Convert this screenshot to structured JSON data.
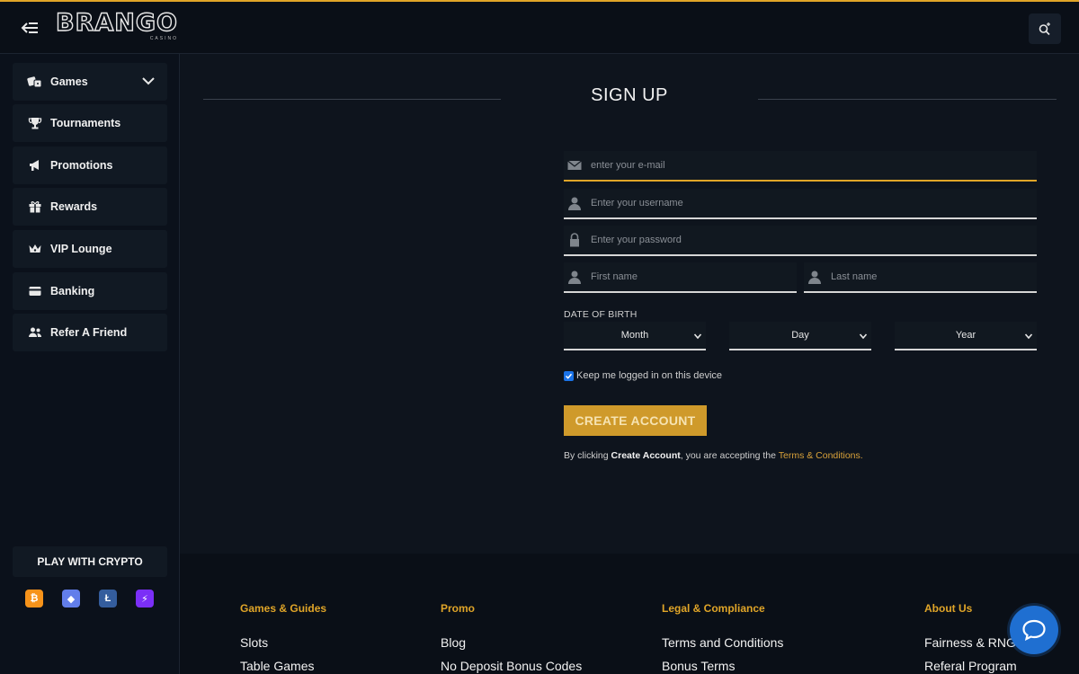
{
  "header": {
    "logo_text": "BRANGO",
    "logo_sub": "CASINO",
    "menu_icon": "menu-collapse-icon",
    "search_icon": "search-icon",
    "accent_color": "#e0a528"
  },
  "sidebar": {
    "items": [
      {
        "label": "Games",
        "icon": "dice-icon"
      },
      {
        "label": "Tournaments",
        "icon": "trophy-icon"
      },
      {
        "label": "Promotions",
        "icon": "megaphone-icon"
      },
      {
        "label": "Rewards",
        "icon": "gift-icon"
      },
      {
        "label": "VIP Lounge",
        "icon": "crown-icon"
      },
      {
        "label": "Banking",
        "icon": "card-icon"
      },
      {
        "label": "Refer A Friend",
        "icon": "users-icon"
      }
    ],
    "crypto_label": "PLAY WITH CRYPTO",
    "coins": [
      {
        "symbol": "₿",
        "name": "bitcoin",
        "color": "#f7931a"
      },
      {
        "symbol": "◆",
        "name": "ethereum",
        "color": "#627eea"
      },
      {
        "symbol": "Ł",
        "name": "litecoin",
        "color": "#345d9d"
      },
      {
        "symbol": "⚡",
        "name": "lightning",
        "color": "#7b2ff7"
      }
    ]
  },
  "signup": {
    "title": "SIGN UP",
    "email_placeholder": "enter your e-mail",
    "username_placeholder": "Enter your username",
    "password_placeholder": "Enter your password",
    "first_name_placeholder": "First name",
    "last_name_placeholder": "Last name",
    "dob_label": "DATE OF BIRTH",
    "month": "Month",
    "day": "Day",
    "year": "Year",
    "keep_logged_in": "Keep me logged in on this device",
    "create_button": "CREATE ACCOUNT",
    "terms_prefix": "By clicking",
    "terms_bold": "Create Account",
    "terms_middle": ", you are accepting the",
    "terms_link": "Terms & Conditions."
  },
  "footer": {
    "columns": [
      {
        "heading": "Games & Guides",
        "links": [
          "Slots",
          "Table Games"
        ]
      },
      {
        "heading": "Promo",
        "links": [
          "Blog",
          "No Deposit Bonus Codes"
        ]
      },
      {
        "heading": "Legal & Compliance",
        "links": [
          "Terms and Conditions",
          "Bonus Terms"
        ]
      },
      {
        "heading": "About Us",
        "links": [
          "Fairness & RNG",
          "Referal Program"
        ]
      }
    ],
    "chat_icon": "chat-bubble-icon"
  }
}
